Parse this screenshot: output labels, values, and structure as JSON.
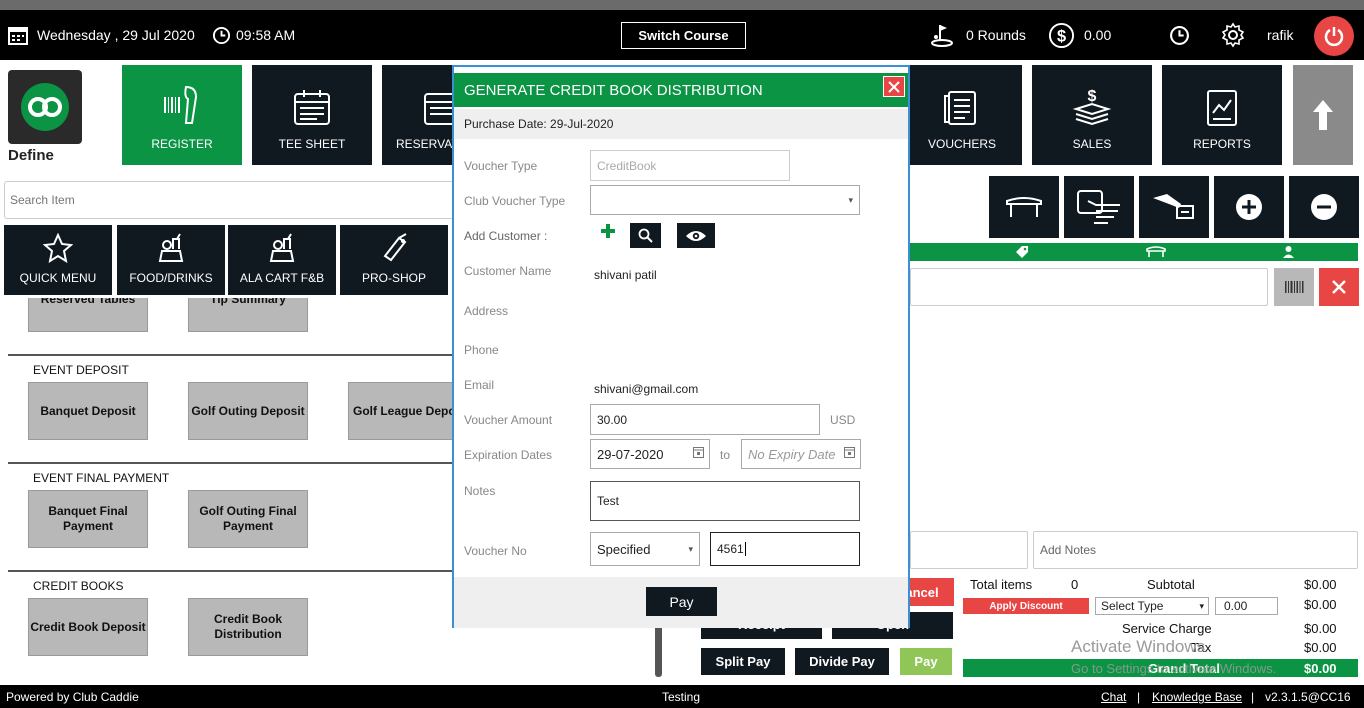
{
  "topbar": {
    "date": "Wednesday ,  29 Jul 2020",
    "time": "09:58 AM",
    "switch_course": "Switch Course",
    "rounds": "0 Rounds",
    "amount": "0.00",
    "user": "rafik"
  },
  "brand": {
    "define": "Define"
  },
  "nav": {
    "register": "REGISTER",
    "tee_sheet": "TEE SHEET",
    "reservations": "RESERVATIONS",
    "vouchers": "VOUCHERS",
    "sales": "SALES",
    "reports": "REPORTS"
  },
  "search": {
    "placeholder": "Search Item"
  },
  "categories": {
    "quick_menu": "QUICK MENU",
    "food_drinks": "FOOD/DRINKS",
    "ala_cart": "ALA CART F&B",
    "pro_shop": "PRO-SHOP"
  },
  "menu": {
    "top_partial": [
      "Reserved Tables",
      "Tip Summary"
    ],
    "sections": {
      "event_deposit": "EVENT DEPOSIT",
      "event_final": "EVENT FINAL PAYMENT",
      "credit_books": "CREDIT BOOKS"
    },
    "event_deposit_items": [
      "Banquet Deposit",
      "Golf Outing Deposit",
      "Golf League Deposit"
    ],
    "event_final_items": [
      "Banquet Final Payment",
      "Golf Outing Final Payment"
    ],
    "credit_books_items": [
      "Credit Book Deposit",
      "Credit Book Distribution"
    ]
  },
  "cart": {
    "notes_placeholder": "Add Notes",
    "cancel": "Cancel",
    "receipt": "Receipt",
    "open": "Open",
    "split_pay": "Split Pay",
    "divide_pay": "Divide Pay",
    "pay": "Pay"
  },
  "totals": {
    "total_items_label": "Total items",
    "total_items": "0",
    "subtotal_label": "Subtotal",
    "subtotal": "$0.00",
    "apply_discount": "Apply Discount",
    "select_type": "Select Type",
    "discount_value": "0.00",
    "discount_amount": "$0.00",
    "service_charge_label": "Service Charge",
    "service_charge": "$0.00",
    "tax_label": "Tax",
    "tax": "$0.00",
    "grand_total_label": "Grand Total",
    "grand_total": "$0.00"
  },
  "watermark": {
    "line1": "Activate Windows",
    "line2": "Go to Settings to activate Windows."
  },
  "modal": {
    "title": "GENERATE CREDIT BOOK DISTRIBUTION",
    "purchase_date": "Purchase Date:  29-Jul-2020",
    "labels": {
      "voucher_type": "Voucher Type",
      "club_voucher_type": "Club Voucher Type",
      "add_customer": "Add Customer :",
      "customer_name": "Customer Name",
      "address": "Address",
      "phone": "Phone",
      "email": "Email",
      "voucher_amount": "Voucher Amount",
      "expiration_dates": "Expiration Dates",
      "notes": "Notes",
      "voucher_no": "Voucher No"
    },
    "values": {
      "voucher_type": "CreditBook",
      "customer_name": "shivani patil",
      "email": "shivani@gmail.com",
      "voucher_amount": "30.00",
      "currency": "USD",
      "expiration_from": "29-07-2020",
      "to": "to",
      "expiration_to_placeholder": "No Expiry Date",
      "notes": "Test",
      "voucher_no_mode": "Specified",
      "voucher_no": "4561"
    },
    "pay": "Pay"
  },
  "footer": {
    "powered": "Powered by Club Caddie",
    "env": "Testing",
    "chat": "Chat",
    "kb": "Knowledge Base",
    "version": "v2.3.1.5@CC16"
  },
  "colors": {
    "green": "#0b9444",
    "dark": "#101820",
    "red": "#e84545",
    "lime": "#8fc657"
  }
}
